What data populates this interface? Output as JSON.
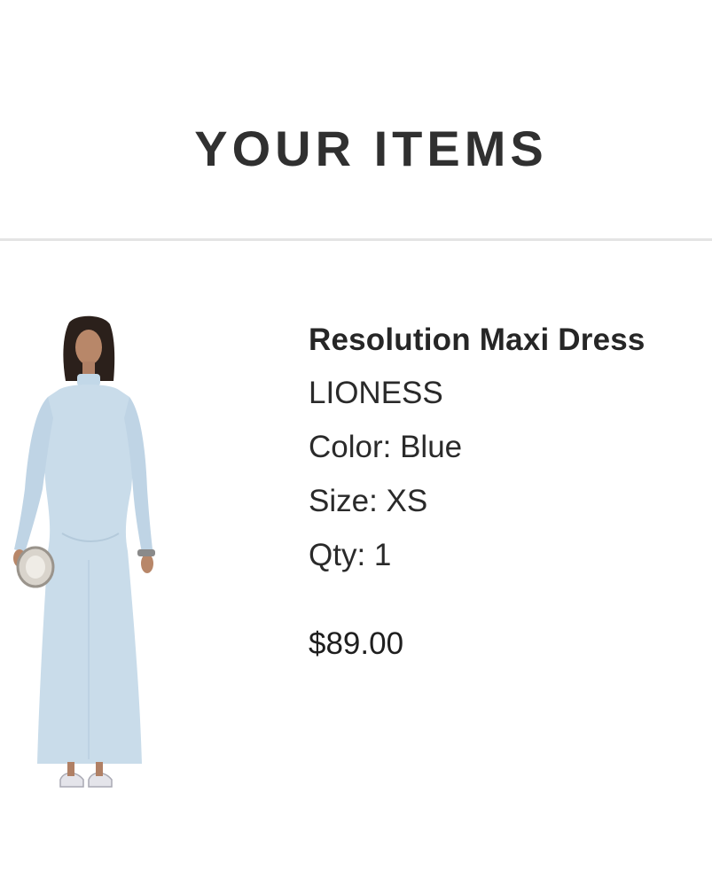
{
  "header": {
    "title": "YOUR ITEMS"
  },
  "item": {
    "name": "Resolution Maxi Dress",
    "brand": "LIONESS",
    "color_line": "Color: Blue",
    "size_line": "Size: XS",
    "qty_line": "Qty: 1",
    "price": "$89.00",
    "image_icon": "product-photo-dress",
    "dress_color": "#c9dcea"
  }
}
